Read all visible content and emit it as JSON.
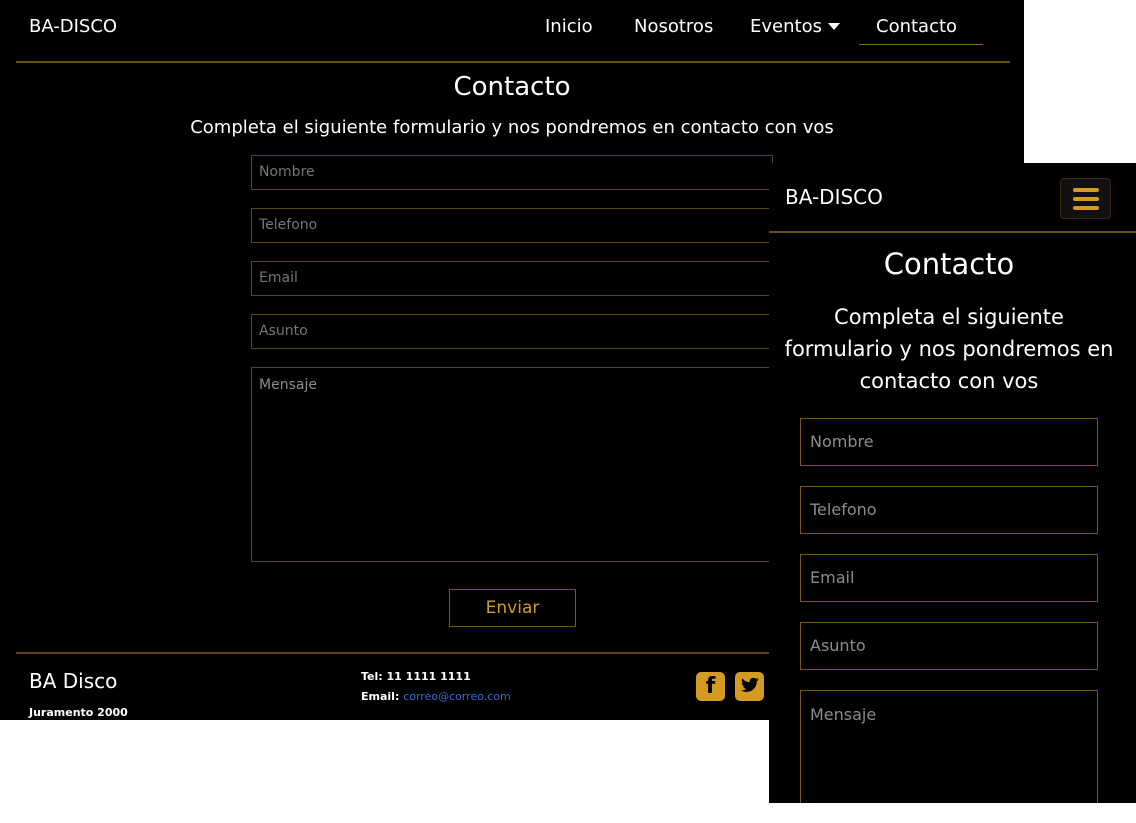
{
  "desktop": {
    "brand": "BA-DISCO",
    "nav": [
      "Inicio",
      "Nosotros",
      "Eventos",
      "Contacto"
    ],
    "title": "Contacto",
    "subtitle": "Completa el siguiente formulario y nos pondremos en contacto con vos",
    "fields": {
      "name": "Nombre",
      "phone": "Telefono",
      "email": "Email",
      "subject": "Asunto",
      "message": "Mensaje"
    },
    "send": "Enviar",
    "footer": {
      "brand": "BA Disco",
      "address": "Juramento 2000",
      "tel_label": "Tel:",
      "tel": "11 1111 1111",
      "email_label": "Email:",
      "email": "correo@correo.com"
    },
    "social_icons": [
      "facebook-icon",
      "twitter-icon"
    ]
  },
  "mobile": {
    "brand": "BA-DISCO",
    "title": "Contacto",
    "subtitle": "Completa el siguiente formulario y nos pondremos en contacto con vos",
    "fields": {
      "name": "Nombre",
      "phone": "Telefono",
      "email": "Email",
      "subject": "Asunto",
      "message": "Mensaje"
    }
  },
  "colors": {
    "background": "#000000",
    "accent": "#d39b22",
    "rule": "#6a4e12",
    "link": "#2f6bd8"
  }
}
